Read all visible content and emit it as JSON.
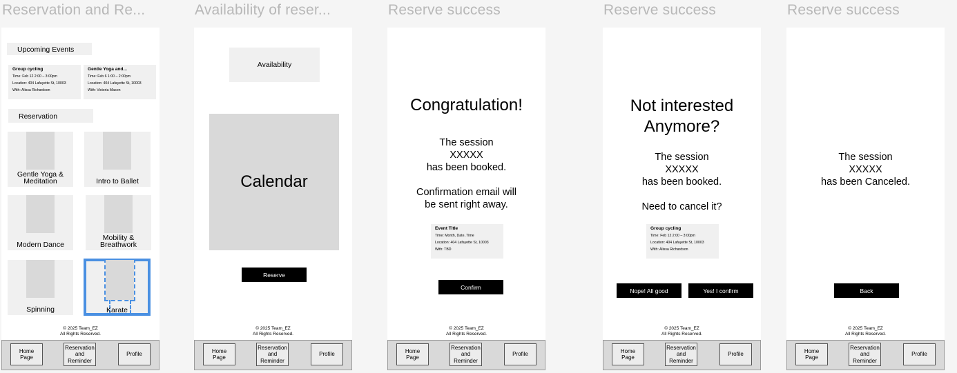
{
  "frames": [
    {
      "title": "Reservation and Re..."
    },
    {
      "title": "Availability of reser..."
    },
    {
      "title": "Reserve success"
    },
    {
      "title": "Reserve success"
    },
    {
      "title": "Reserve success"
    }
  ],
  "footer": {
    "line1": "© 2025 Team_EZ",
    "line2": "All Rights Reserved."
  },
  "tabbar": {
    "home_l1": "Home",
    "home_l2": "Page",
    "res_l1": "Reservation",
    "res_l2": "and",
    "res_l3": "Reminder",
    "profile": "Profile"
  },
  "screen1": {
    "upcoming_heading": "Upcoming Events",
    "events": [
      {
        "title": "Group cycling",
        "time": "Time: Feb 12 2:00 – 3:00pm",
        "location": "Location: 404 Lafayette St, 10003",
        "with": "With: Alissa Richardson"
      },
      {
        "title": "Gentle Yoga and...",
        "time": "Time: Feb 6 1:00 – 2:00pm",
        "location": "Location: 404 Lafayette St, 10003",
        "with": "With: Victoria Mason"
      }
    ],
    "reservation_heading": "Reservation",
    "classes": [
      {
        "l1": "Gentle Yoga &",
        "l2": "Meditation"
      },
      {
        "l1": "Intro to Ballet",
        "l2": ""
      },
      {
        "l1": "Modern Dance",
        "l2": ""
      },
      {
        "l1": "Mobility &",
        "l2": "Breathwork"
      },
      {
        "l1": "Spinning",
        "l2": ""
      },
      {
        "l1": "Karate",
        "l2": ""
      }
    ]
  },
  "screen2": {
    "availability": "Availability",
    "calendar": "Calendar",
    "reserve": "Reserve"
  },
  "screen3": {
    "heading": "Congratulation!",
    "msg1": "The session",
    "msg2": "XXXXX",
    "msg3": "has been booked.",
    "msg4": "Confirmation email will",
    "msg5": "be sent right away.",
    "card": {
      "title": "Event Title",
      "time": "Time: Month, Date, Time",
      "location": "Location: 404 Lafayette St, 10003",
      "with": "With: TBD"
    },
    "confirm": "Confirm"
  },
  "screen4": {
    "heading1": "Not interested",
    "heading2": "Anymore?",
    "msg1": "The session",
    "msg2": "XXXXX",
    "msg3": "has been booked.",
    "question": "Need to cancel it?",
    "card": {
      "title": "Group cycling",
      "time": "Time: Feb 12 2:00 – 3:00pm",
      "location": "Location: 404 Lafayette St, 10003",
      "with": "With: Alissa Richardson"
    },
    "nope": "Nope! All good",
    "yes": "Yes! I confirm"
  },
  "screen5": {
    "msg1": "The session",
    "msg2": "XXXXX",
    "msg3": "has been Canceled.",
    "back": "Back"
  },
  "colors": {
    "selection": "#4a90e2",
    "placeholder": "#d9d9d9",
    "card": "#f0f0f0",
    "button": "#000000"
  }
}
